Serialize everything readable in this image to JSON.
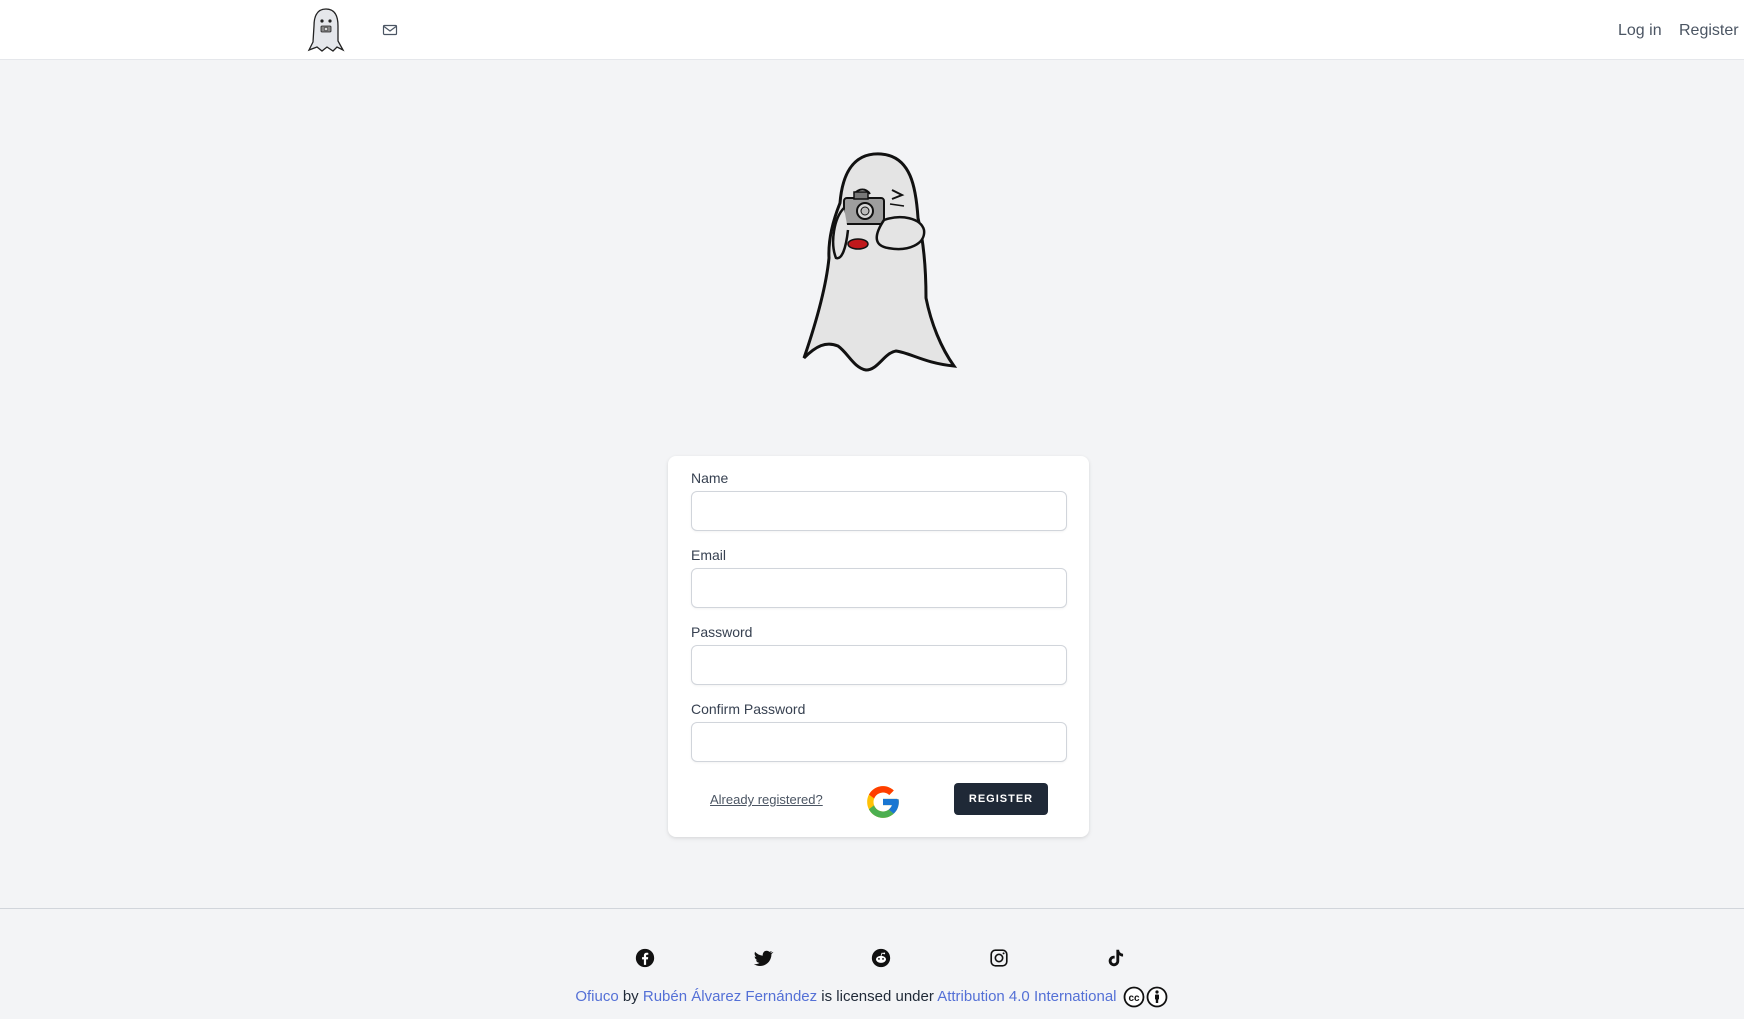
{
  "nav": {
    "login_label": "Log in",
    "register_label": "Register",
    "logo_icon": "ghost-logo-icon",
    "mail_icon": "mail-icon"
  },
  "form": {
    "name_label": "Name",
    "name_value": "",
    "email_label": "Email",
    "email_value": "",
    "password_label": "Password",
    "password_value": "",
    "confirm_label": "Confirm Password",
    "confirm_value": "",
    "already_registered": "Already registered?",
    "google_icon": "google-icon",
    "register_button": "REGISTER"
  },
  "footer": {
    "social_icons": [
      "facebook-icon",
      "twitter-icon",
      "reddit-icon",
      "instagram-icon",
      "tiktok-icon"
    ],
    "project": "Ofiuco",
    "by": "by",
    "author": "Rubén Álvarez Fernández",
    "licensed": "is licensed under",
    "license": "Attribution 4.0 International"
  },
  "colors": {
    "background": "#f3f4f6",
    "button_dark": "#1f2937",
    "link_blue": "#5470d6"
  }
}
